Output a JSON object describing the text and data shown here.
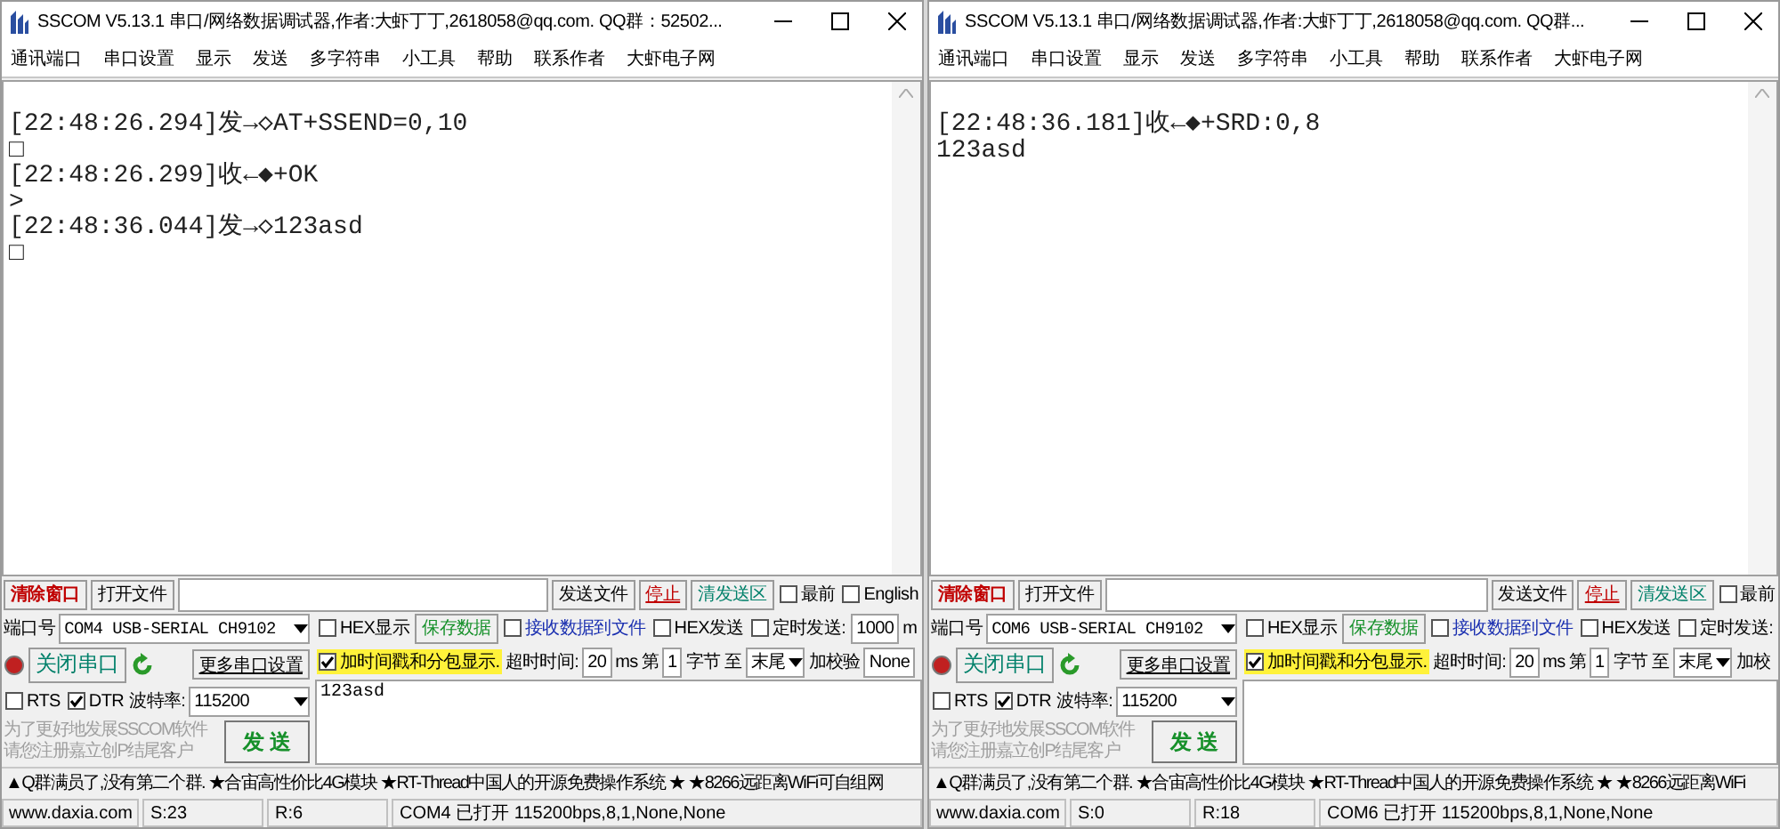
{
  "windows": [
    {
      "title": "SSCOM V5.13.1 串口/网络数据调试器,作者:大虾丁丁,2618058@qq.com. QQ群：52502...",
      "menu": [
        "通讯端口",
        "串口设置",
        "显示",
        "发送",
        "多字符串",
        "小工具",
        "帮助",
        "联系作者",
        "大虾电子网"
      ],
      "log": [
        "[22:48:26.294]发→◇AT+SSEND=0,10",
        "□",
        "[22:48:26.299]收←◆+OK",
        ">",
        "[22:48:36.044]发→◇123asd",
        "□"
      ],
      "top_left_buttons": [
        {
          "label": "清除窗口",
          "kind": "danger"
        },
        {
          "label": "打开文件",
          "kind": "plain"
        }
      ],
      "top_right_buttons": [
        {
          "label": "发送文件",
          "kind": "plain"
        },
        {
          "label": "停止",
          "kind": "stop"
        },
        {
          "label": "清发送区",
          "kind": "teal"
        }
      ],
      "top_options": [
        {
          "label": "最前",
          "checked": false
        },
        {
          "label": "English",
          "checked": false
        }
      ],
      "port": {
        "label": "端口号",
        "value": "COM4 USB-SERIAL CH9102",
        "open_button": "关闭串口",
        "more_button": "更多串口设置",
        "rts": {
          "label": "RTS",
          "checked": false
        },
        "dtr": {
          "label": "DTR",
          "checked": true
        },
        "baud_label": "波特率:",
        "baud": "115200",
        "promo": [
          "为了更好地发展SSCOM软件",
          "请您注册嘉立创P结尾客户"
        ],
        "send_button": "发 送"
      },
      "row_1": [
        {
          "kind": "checkbox",
          "label": "HEX显示",
          "checked": false
        },
        {
          "kind": "button",
          "label": "保存数据"
        },
        {
          "kind": "checkbox",
          "label": "接收数据到文件",
          "checked": false,
          "color": "#1a2fb0"
        },
        {
          "kind": "checkbox",
          "label": "HEX发送",
          "checked": false
        },
        {
          "kind": "checkbox",
          "label": "定时发送:",
          "checked": false
        },
        {
          "kind": "input",
          "value": "1000"
        },
        {
          "kind": "text",
          "label": "m"
        }
      ],
      "row_2": [
        {
          "kind": "checkbox",
          "label": "加时间戳和分包显示.",
          "checked": true,
          "highlight": true
        },
        {
          "kind": "text",
          "label": "超时时间:"
        },
        {
          "kind": "input",
          "value": "20"
        },
        {
          "kind": "text",
          "label": "ms"
        },
        {
          "kind": "text",
          "label": "第"
        },
        {
          "kind": "input",
          "value": "1"
        },
        {
          "kind": "text",
          "label": "字节 至"
        },
        {
          "kind": "select",
          "value": "末尾"
        },
        {
          "kind": "text",
          "label": "加校验"
        },
        {
          "kind": "input",
          "value": "None"
        }
      ],
      "send_text": "123asd",
      "ticker": "▲Q群满员了,没有第二个群. ★合宙高性价比4G模块 ★RT-Thread中国人的开源免费操作系统 ★ ★8266远距离WiFi可自组网",
      "status": [
        "www.daxia.com",
        "S:23",
        "R:6",
        "COM4 已打开  115200bps,8,1,None,None"
      ]
    },
    {
      "title": "SSCOM V5.13.1 串口/网络数据调试器,作者:大虾丁丁,2618058@qq.com. QQ群...",
      "menu": [
        "通讯端口",
        "串口设置",
        "显示",
        "发送",
        "多字符串",
        "小工具",
        "帮助",
        "联系作者",
        "大虾电子网"
      ],
      "log": [
        "[22:48:36.181]收←◆+SRD:0,8",
        "123asd"
      ],
      "top_left_buttons": [
        {
          "label": "清除窗口",
          "kind": "danger"
        },
        {
          "label": "打开文件",
          "kind": "plain"
        }
      ],
      "top_right_buttons": [
        {
          "label": "发送文件",
          "kind": "plain"
        },
        {
          "label": "停止",
          "kind": "stop"
        },
        {
          "label": "清发送区",
          "kind": "teal"
        }
      ],
      "top_options": [
        {
          "label": "最前",
          "checked": false
        }
      ],
      "port": {
        "label": "端口号",
        "value": "COM6 USB-SERIAL CH9102",
        "open_button": "关闭串口",
        "more_button": "更多串口设置",
        "rts": {
          "label": "RTS",
          "checked": false
        },
        "dtr": {
          "label": "DTR",
          "checked": true
        },
        "baud_label": "波特率:",
        "baud": "115200",
        "promo": [
          "为了更好地发展SSCOM软件",
          "请您注册嘉立创P结尾客户"
        ],
        "send_button": "发 送"
      },
      "row_1": [
        {
          "kind": "checkbox",
          "label": "HEX显示",
          "checked": false
        },
        {
          "kind": "button",
          "label": "保存数据"
        },
        {
          "kind": "checkbox",
          "label": "接收数据到文件",
          "checked": false,
          "color": "#1a2fb0"
        },
        {
          "kind": "checkbox",
          "label": "HEX发送",
          "checked": false
        },
        {
          "kind": "checkbox",
          "label": "定时发送:",
          "checked": false
        }
      ],
      "row_2": [
        {
          "kind": "checkbox",
          "label": "加时间戳和分包显示.",
          "checked": true,
          "highlight": true
        },
        {
          "kind": "text",
          "label": "超时时间:"
        },
        {
          "kind": "input",
          "value": "20"
        },
        {
          "kind": "text",
          "label": "ms"
        },
        {
          "kind": "text",
          "label": "第"
        },
        {
          "kind": "input",
          "value": "1"
        },
        {
          "kind": "text",
          "label": "字节 至"
        },
        {
          "kind": "select",
          "value": "末尾"
        },
        {
          "kind": "text",
          "label": "加校"
        }
      ],
      "ticker": "▲Q群满员了,没有第二个群. ★合宙高性价比4G模块 ★RT-Thread中国人的开源免费操作系统 ★ ★8266远距离WiFi",
      "status": [
        "www.daxia.com",
        "S:0",
        "R:18",
        "COM6 已打开  115200bps,8,1,None,None"
      ]
    }
  ]
}
